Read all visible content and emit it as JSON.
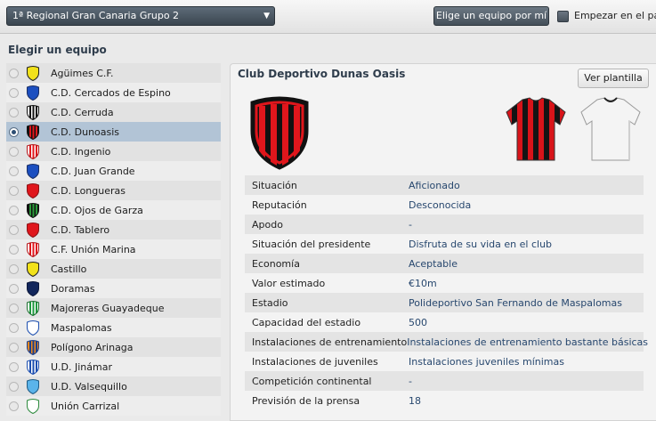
{
  "header": {
    "league": "1ª Regional Gran Canaria Grupo 2",
    "pick_button": "Elige un equipo por mí",
    "start_label": "Empezar en el paro"
  },
  "section_title": "Elegir un equipo",
  "teams": [
    {
      "name": "Agüimes C.F.",
      "crest_icon": "shield-yellow-icon",
      "selected": false
    },
    {
      "name": "C.D. Cercados de Espino",
      "crest_icon": "shield-blue-icon",
      "selected": false
    },
    {
      "name": "C.D. Cerruda",
      "crest_icon": "shield-black-white-stripes-icon",
      "selected": false
    },
    {
      "name": "C.D. Dunoasis",
      "crest_icon": "shield-red-black-stripes-icon",
      "selected": true
    },
    {
      "name": "C.D. Ingenio",
      "crest_icon": "shield-red-white-stripes-icon",
      "selected": false
    },
    {
      "name": "C.D. Juan Grande",
      "crest_icon": "shield-blue-icon",
      "selected": false
    },
    {
      "name": "C.D. Longueras",
      "crest_icon": "shield-red-icon",
      "selected": false
    },
    {
      "name": "C.D. Ojos de Garza",
      "crest_icon": "shield-black-green-icon",
      "selected": false
    },
    {
      "name": "C.D. Tablero",
      "crest_icon": "shield-red-icon",
      "selected": false
    },
    {
      "name": "C.F. Unión Marina",
      "crest_icon": "shield-red-white-stripes-icon",
      "selected": false
    },
    {
      "name": "Castillo",
      "crest_icon": "shield-yellow-icon",
      "selected": false
    },
    {
      "name": "Doramas",
      "crest_icon": "shield-navy-icon",
      "selected": false
    },
    {
      "name": "Majoreras Guayadeque",
      "crest_icon": "shield-green-white-stripes-icon",
      "selected": false
    },
    {
      "name": "Maspalomas",
      "crest_icon": "shield-white-blue-icon",
      "selected": false
    },
    {
      "name": "Polígono Arinaga",
      "crest_icon": "shield-orange-blue-icon",
      "selected": false
    },
    {
      "name": "U.D. Jinámar",
      "crest_icon": "shield-blue-white-stripes-icon",
      "selected": false
    },
    {
      "name": "U.D. Valsequillo",
      "crest_icon": "shield-light-blue-icon",
      "selected": false
    },
    {
      "name": "Unión Carrizal",
      "crest_icon": "shield-white-green-icon",
      "selected": false
    }
  ],
  "club": {
    "title": "Club Deportivo Dunas Oasis",
    "squad_button": "Ver plantilla",
    "crest_icon": "shield-red-black-stripes-icon",
    "home_kit_icon": "red-black-striped-shirt-icon",
    "away_kit_icon": "white-shirt-icon"
  },
  "info": [
    {
      "label": "Situación",
      "value": "Aficionado"
    },
    {
      "label": "Reputación",
      "value": "Desconocida"
    },
    {
      "label": "Apodo",
      "value": "-"
    },
    {
      "label": "Situación del presidente",
      "value": "Disfruta de su vida en el club"
    },
    {
      "label": "Economía",
      "value": "Aceptable"
    },
    {
      "label": "Valor estimado",
      "value": "€10m"
    },
    {
      "label": "Estadio",
      "value": "Polideportivo San Fernando de Maspalomas"
    },
    {
      "label": "Capacidad del estadio",
      "value": "500"
    },
    {
      "label": "Instalaciones de entrenamiento",
      "value": "Instalaciones de entrenamiento bastante básicas"
    },
    {
      "label": "Instalaciones de juveniles",
      "value": "Instalaciones juveniles mínimas"
    },
    {
      "label": "Competición continental",
      "value": "-"
    },
    {
      "label": "Previsión de la prensa",
      "value": "18"
    }
  ],
  "colors": {
    "accent": "#2f3d4c",
    "selected_row": "#b2c4d6",
    "value_text": "#27476e",
    "club_red": "#e0161c",
    "club_black": "#111111"
  }
}
